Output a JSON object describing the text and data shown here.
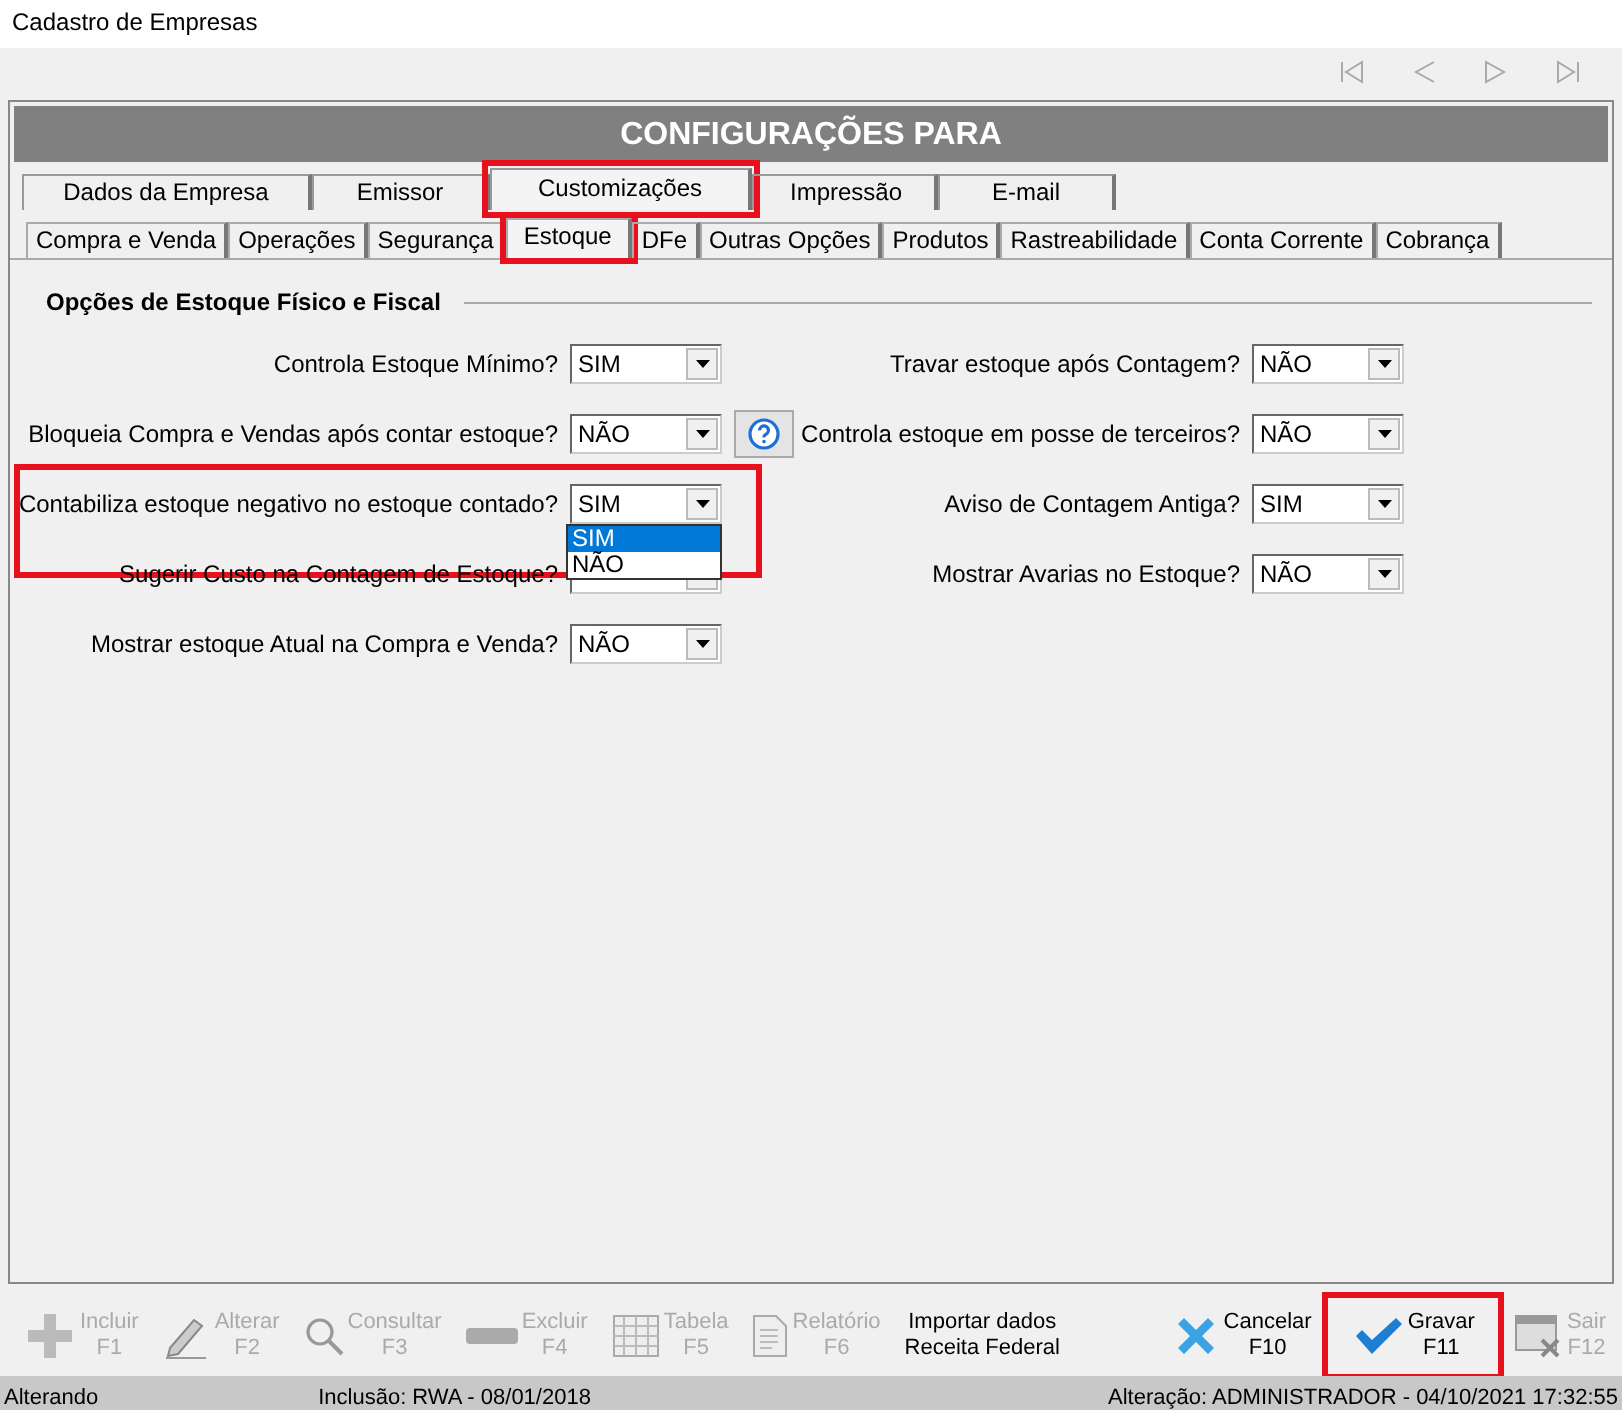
{
  "window": {
    "title": "Cadastro de Empresas"
  },
  "header": "CONFIGURAÇÕES PARA",
  "tabs": [
    {
      "label": "Dados da Empresa",
      "selected": false,
      "highlighted": false
    },
    {
      "label": "Emissor",
      "selected": false,
      "highlighted": false
    },
    {
      "label": "Customizações",
      "selected": true,
      "highlighted": true
    },
    {
      "label": "Impressão",
      "selected": false,
      "highlighted": false
    },
    {
      "label": "E-mail",
      "selected": false,
      "highlighted": false
    }
  ],
  "subtabs": [
    {
      "label": "Compra e Venda",
      "selected": false,
      "highlighted": false
    },
    {
      "label": "Operações",
      "selected": false,
      "highlighted": false
    },
    {
      "label": "Segurança",
      "selected": false,
      "highlighted": false
    },
    {
      "label": "Estoque",
      "selected": true,
      "highlighted": true
    },
    {
      "label": "DFe",
      "selected": false,
      "highlighted": false
    },
    {
      "label": "Outras Opções",
      "selected": false,
      "highlighted": false
    },
    {
      "label": "Produtos",
      "selected": false,
      "highlighted": false
    },
    {
      "label": "Rastreabilidade",
      "selected": false,
      "highlighted": false
    },
    {
      "label": "Conta Corrente",
      "selected": false,
      "highlighted": false
    },
    {
      "label": "Cobrança",
      "selected": false,
      "highlighted": false
    }
  ],
  "section": {
    "title": "Opções de Estoque Físico e Fiscal",
    "left": [
      {
        "label": "Controla Estoque Mínimo?",
        "value": "SIM"
      },
      {
        "label": "Bloqueia Compra e Vendas após contar estoque?",
        "value": "NÃO",
        "help": true
      },
      {
        "label": "Contabiliza estoque negativo no estoque contado?",
        "value": "SIM",
        "highlighted": true,
        "options": [
          {
            "label": "SIM",
            "selected": true
          },
          {
            "label": "NÃO",
            "selected": false
          }
        ]
      },
      {
        "label": "Sugerir Custo na Contagem de Estoque?"
      },
      {
        "label": "Mostrar estoque Atual na Compra e Venda?",
        "value": "NÃO"
      }
    ],
    "right": [
      {
        "label": "Travar estoque após Contagem?",
        "value": "NÃO"
      },
      {
        "label": "Controla estoque em posse de terceiros?",
        "value": "NÃO"
      },
      {
        "label": "Aviso de Contagem Antiga?",
        "value": "SIM"
      },
      {
        "label": "Mostrar Avarias no Estoque?",
        "value": "NÃO"
      }
    ]
  },
  "toolbar": [
    {
      "kind": "plus",
      "label": "Incluir",
      "key": "F1",
      "disabled": true,
      "highlighted": false
    },
    {
      "kind": "pencil",
      "label": "Alterar",
      "key": "F2",
      "disabled": true,
      "highlighted": false
    },
    {
      "kind": "search",
      "label": "Consultar",
      "key": "F3",
      "disabled": true,
      "highlighted": false
    },
    {
      "kind": "minus",
      "label": "Excluir",
      "key": "F4",
      "disabled": true,
      "highlighted": false
    },
    {
      "kind": "table",
      "label": "Tabela",
      "key": "F5",
      "disabled": true,
      "highlighted": false
    },
    {
      "kind": "report",
      "label": "Relatório",
      "key": "F6",
      "disabled": true,
      "highlighted": false
    },
    {
      "kind": "text",
      "label": "Importar dados",
      "key": "Receita Federal",
      "disabled": false,
      "highlighted": false
    },
    {
      "kind": "cancel",
      "label": "Cancelar",
      "key": "F10",
      "disabled": false,
      "highlighted": false
    },
    {
      "kind": "check",
      "label": "Gravar",
      "key": "F11",
      "disabled": false,
      "highlighted": true
    },
    {
      "kind": "exit",
      "label": "Sair",
      "key": "F12",
      "disabled": true,
      "highlighted": false
    }
  ],
  "status_bar": {
    "left": "Alterando",
    "center": "Inclusão: RWA - 08/01/2018",
    "right": "Alteração: ADMINISTRADOR - 04/10/2021 17:32:55"
  }
}
